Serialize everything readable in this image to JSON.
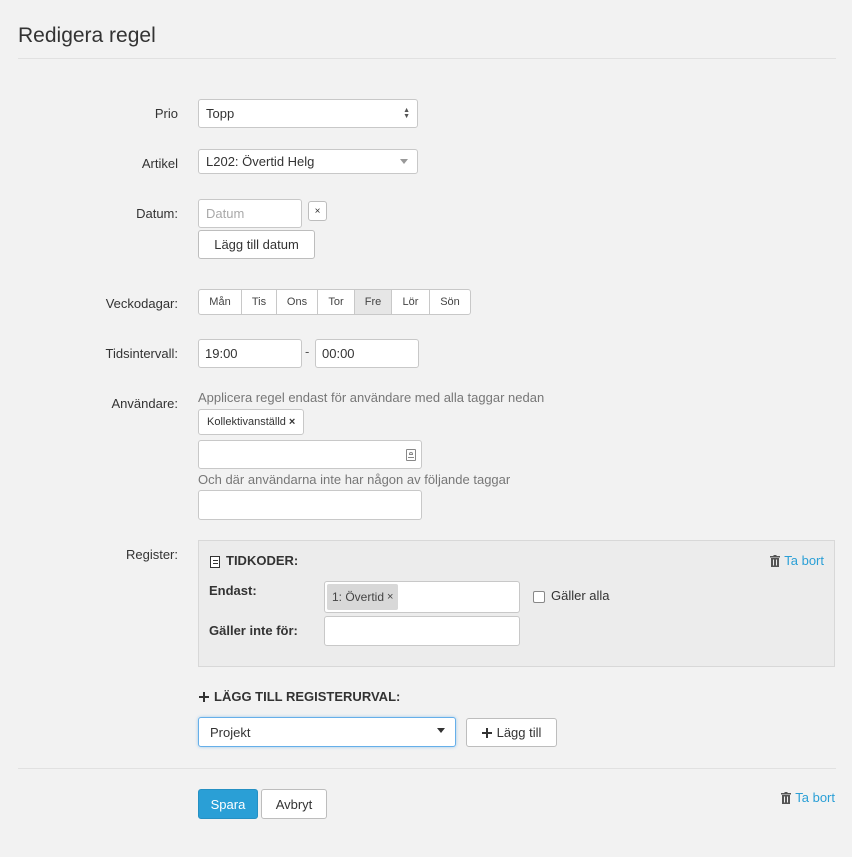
{
  "page": {
    "title": "Redigera regel"
  },
  "prio": {
    "label": "Prio",
    "value": "Topp"
  },
  "artikel": {
    "label": "Artikel",
    "value": "L202: Övertid Helg"
  },
  "datum": {
    "label": "Datum:",
    "placeholder": "Datum",
    "clear_label": "×",
    "add_label": "Lägg till datum"
  },
  "veckodagar": {
    "label": "Veckodagar:",
    "days": [
      {
        "label": "Mån",
        "active": false
      },
      {
        "label": "Tis",
        "active": false
      },
      {
        "label": "Ons",
        "active": false
      },
      {
        "label": "Tor",
        "active": false
      },
      {
        "label": "Fre",
        "active": true
      },
      {
        "label": "Lör",
        "active": false
      },
      {
        "label": "Sön",
        "active": false
      }
    ]
  },
  "tidsintervall": {
    "label": "Tidsintervall:",
    "from": "19:00",
    "separator": "-",
    "to": "00:00"
  },
  "anvandare": {
    "label": "Användare:",
    "hint_include": "Applicera regel endast för användare med alla taggar nedan",
    "tags": [
      "Kollektivanställd"
    ],
    "tag_remove": "×",
    "hint_exclude": "Och där användarna inte har någon av följande taggar",
    "input_icon": "contact-card-icon"
  },
  "register": {
    "label": "Register:",
    "section_title": "TIDKODER:",
    "remove_label": "Ta bort",
    "endast_label": "Endast:",
    "endast_chips": [
      "1: Övertid"
    ],
    "chip_remove": "×",
    "galler_alla_label": "Gäller alla",
    "galler_inte_label": "Gäller inte för:",
    "add_section_label": "LÄGG TILL REGISTERURVAL:",
    "select_value": "Projekt",
    "add_button_label": "Lägg till"
  },
  "footer": {
    "save_label": "Spara",
    "cancel_label": "Avbryt",
    "delete_label": "Ta bort"
  },
  "colors": {
    "accent": "#2a9fd6",
    "background": "#f2f2f2"
  }
}
